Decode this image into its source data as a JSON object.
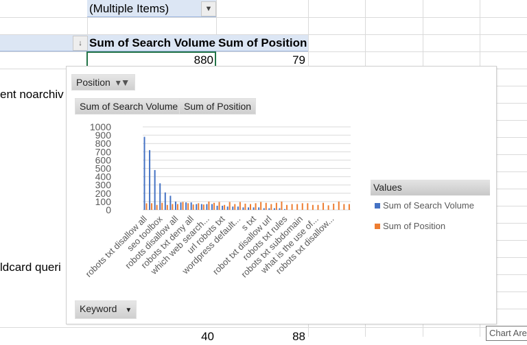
{
  "sheet": {
    "filter_value": "(Multiple Items)",
    "header_col1": "Sum of Search Volume",
    "header_col2": "Sum of Position",
    "row1_volume": "880",
    "row1_position": "79",
    "left_text_1": "ent noarchiv",
    "left_text_2": "ldcard queri",
    "bottom_volume": "40",
    "bottom_position": "88"
  },
  "chart": {
    "filter_button": "Position",
    "value_buttons": [
      "Sum of Search Volume",
      "Sum of Position"
    ],
    "axis_button": "Keyword",
    "legend_title": "Values",
    "colors": {
      "volume": "#4472c4",
      "position": "#ed7d31"
    },
    "tooltip": "Chart Area"
  },
  "chart_data": {
    "type": "bar",
    "title": "",
    "xlabel": "Keyword",
    "ylabel": "",
    "ylim": [
      0,
      1000
    ],
    "yticks": [
      "0",
      "100",
      "200",
      "300",
      "400",
      "500",
      "600",
      "700",
      "800",
      "900",
      "1000"
    ],
    "category_labels": [
      "robots txt disallow all",
      "seo toolbox",
      "robots disallow all",
      "robots txt deny all",
      "which web search...",
      "url robots txt",
      "wordpress default...",
      "s txt",
      "robot txt disallow url",
      "robots txt rules",
      "robots txt subdomain",
      "what is the use of...",
      "robots txt disallow..."
    ],
    "label_every": 3,
    "series": [
      {
        "name": "Sum of Search Volume",
        "values": [
          880,
          720,
          480,
          320,
          210,
          170,
          100,
          90,
          90,
          90,
          70,
          70,
          70,
          70,
          50,
          50,
          40,
          40,
          40,
          30,
          30,
          30,
          30,
          20,
          20,
          20,
          20,
          10,
          0,
          0,
          0,
          0,
          0,
          0,
          0,
          0,
          0,
          0,
          0,
          0
        ]
      },
      {
        "name": "Sum of Position",
        "values": [
          79,
          80,
          60,
          85,
          60,
          70,
          70,
          95,
          80,
          65,
          80,
          65,
          100,
          85,
          95,
          60,
          95,
          70,
          95,
          75,
          70,
          80,
          95,
          85,
          70,
          85,
          100,
          60,
          70,
          70,
          80,
          80,
          60,
          60,
          85,
          55,
          75,
          100,
          70,
          70
        ]
      }
    ],
    "legend": "right"
  }
}
